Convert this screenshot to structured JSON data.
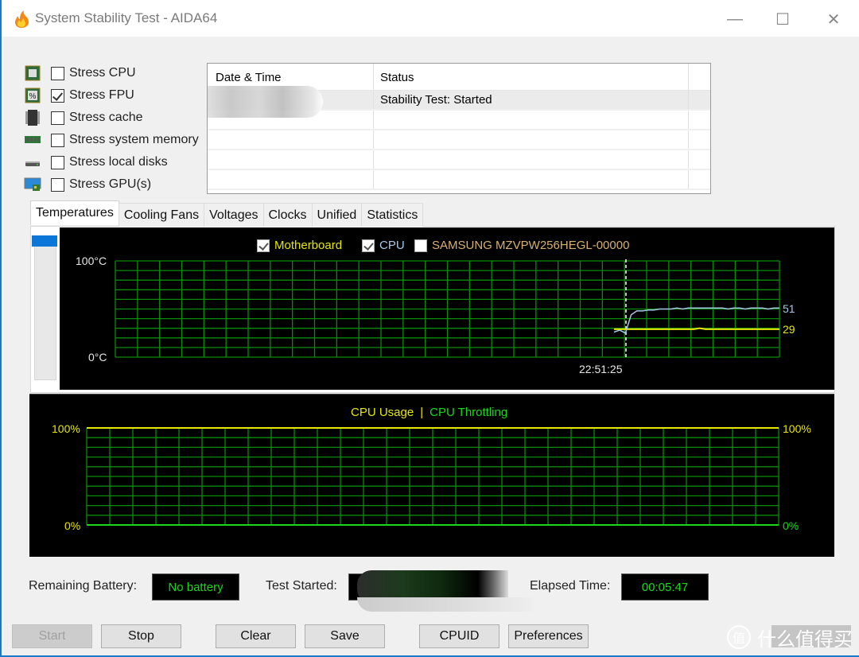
{
  "window": {
    "title": "System Stability Test - AIDA64",
    "controls": {
      "minimize": "—",
      "maximize": "☐",
      "close": "✕"
    }
  },
  "stress_options": [
    {
      "label": "Stress CPU",
      "checked": false,
      "icon": "cpu-chip-icon"
    },
    {
      "label": "Stress FPU",
      "checked": true,
      "icon": "fpu-chip-icon"
    },
    {
      "label": "Stress cache",
      "checked": false,
      "icon": "cache-chip-icon"
    },
    {
      "label": "Stress system memory",
      "checked": false,
      "icon": "memory-module-icon"
    },
    {
      "label": "Stress local disks",
      "checked": false,
      "icon": "hard-disk-icon"
    },
    {
      "label": "Stress GPU(s)",
      "checked": false,
      "icon": "gpu-monitor-icon"
    }
  ],
  "log": {
    "columns": [
      "Date & Time",
      "Status"
    ],
    "rows": [
      {
        "datetime": "",
        "status": "Stability Test: Started"
      }
    ]
  },
  "tabs": [
    "Temperatures",
    "Cooling Fans",
    "Voltages",
    "Clocks",
    "Unified",
    "Statistics"
  ],
  "active_tab": "Temperatures",
  "chart_data": [
    {
      "type": "line",
      "title": "Temperatures",
      "legend": [
        {
          "label": "Motherboard",
          "checked": true,
          "color": "#e6e600"
        },
        {
          "label": "CPU",
          "checked": true,
          "color": "#a8c8e8"
        },
        {
          "label": "SAMSUNG MZVPW256HEGL-00000",
          "checked": false,
          "color": "#d8b070"
        }
      ],
      "ylabel_top": "100°C",
      "ylabel_bottom": "0°C",
      "ylim": [
        0,
        100
      ],
      "grid": true,
      "marker_time": "22:51:25",
      "series": [
        {
          "name": "Motherboard",
          "color": "#e6e600",
          "current": 29,
          "values": [
            29,
            29,
            29,
            29,
            29,
            29,
            29,
            29,
            29,
            29,
            29,
            29,
            29,
            29,
            29,
            30,
            29,
            29,
            29,
            29,
            29,
            29,
            29,
            29,
            29,
            29,
            29,
            29,
            29,
            29
          ]
        },
        {
          "name": "CPU",
          "color": "#a8c8e8",
          "current": 51,
          "values": [
            26,
            28,
            25,
            44,
            48,
            48,
            49,
            49,
            50,
            50,
            50,
            51,
            50,
            51,
            51,
            51,
            51,
            51,
            51,
            51,
            50,
            51,
            51,
            50,
            51,
            51,
            51,
            50,
            51,
            51
          ]
        }
      ],
      "right_labels": [
        "51",
        "29"
      ]
    },
    {
      "type": "line",
      "title": "CPU Usage | CPU Throttling",
      "legend": [
        {
          "label": "CPU Usage",
          "color": "#e6e600"
        },
        {
          "label": "CPU Throttling",
          "color": "#17d917"
        }
      ],
      "separator": "|",
      "ylim": [
        0,
        100
      ],
      "grid": true,
      "left_labels": {
        "top": "100%",
        "bottom": "0%"
      },
      "right_labels": {
        "top": "100%",
        "bottom": "0%"
      },
      "series": [
        {
          "name": "CPU Usage",
          "color": "#e6e600",
          "value": 100
        },
        {
          "name": "CPU Throttling",
          "color": "#17d917",
          "value": 0
        }
      ]
    }
  ],
  "status": {
    "battery_label": "Remaining Battery:",
    "battery_value": "No battery",
    "test_started_label": "Test Started:",
    "test_started_value": "",
    "elapsed_label": "Elapsed Time:",
    "elapsed_value": "00:05:47"
  },
  "buttons": {
    "start": "Start",
    "stop": "Stop",
    "clear": "Clear",
    "save": "Save",
    "cpuid": "CPUID",
    "preferences": "Preferences"
  },
  "watermark": {
    "glyph": "值",
    "text": "什么值得买"
  }
}
